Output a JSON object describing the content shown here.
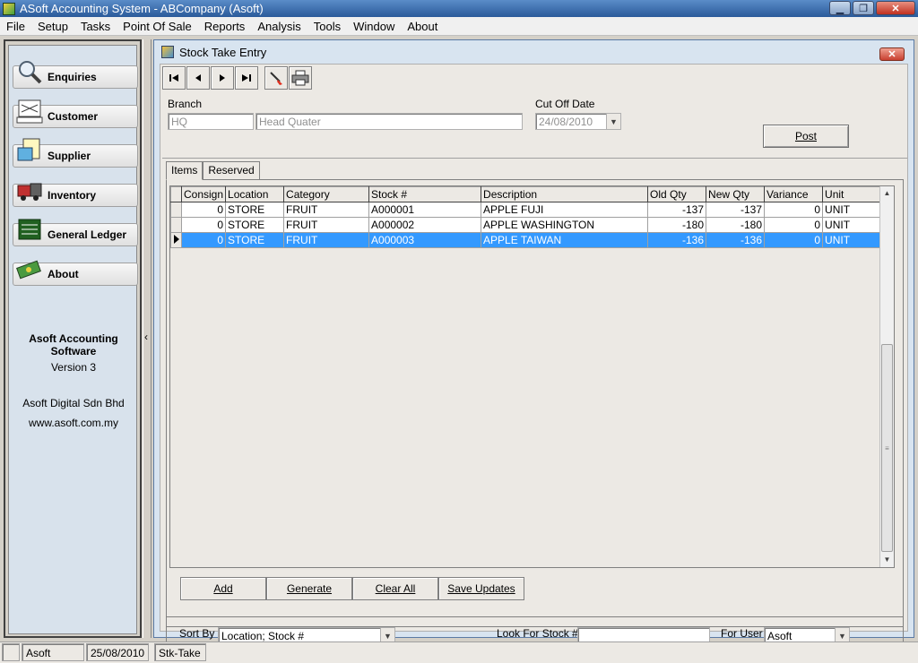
{
  "window": {
    "title": "ASoft Accounting System - ABCompany (Asoft)",
    "minimize": "▁",
    "restore": "❐",
    "close": "✕"
  },
  "menu": [
    "File",
    "Setup",
    "Tasks",
    "Point Of Sale",
    "Reports",
    "Analysis",
    "Tools",
    "Window",
    "About"
  ],
  "sidebar": {
    "items": [
      {
        "label": "Enquiries",
        "icon": "magnifier-icon"
      },
      {
        "label": "Customer",
        "icon": "received-stamp-icon"
      },
      {
        "label": "Supplier",
        "icon": "invoice-icon"
      },
      {
        "label": "Inventory",
        "icon": "delivery-truck-icon"
      },
      {
        "label": "General Ledger",
        "icon": "ledger-book-icon"
      },
      {
        "label": "About",
        "icon": "money-icon"
      }
    ],
    "about": {
      "product": "Asoft Accounting Software",
      "version": "Version 3",
      "company": "Asoft Digital Sdn Bhd",
      "website": "www.asoft.com.my"
    },
    "collapse_arrow": "‹"
  },
  "form": {
    "title": "Stock Take Entry",
    "close": "✕",
    "branch_label": "Branch",
    "branch_code": "HQ",
    "branch_name": "Head Quater",
    "cutoff_label": "Cut Off Date",
    "cutoff_value": "24/08/2010",
    "post_label": "Post",
    "tabs": [
      "Items",
      "Reserved"
    ],
    "grid": {
      "columns": [
        "Consign",
        "Location",
        "Category",
        "Stock #",
        "Description",
        "Old Qty",
        "New Qty",
        "Variance",
        "Unit"
      ],
      "rows": [
        {
          "consign": "0",
          "location": "STORE",
          "category": "FRUIT",
          "stock": "A000001",
          "description": "APPLE FUJI",
          "old_qty": "-137",
          "new_qty": "-137",
          "variance": "0",
          "unit": "UNIT"
        },
        {
          "consign": "0",
          "location": "STORE",
          "category": "FRUIT",
          "stock": "A000002",
          "description": "APPLE WASHINGTON",
          "old_qty": "-180",
          "new_qty": "-180",
          "variance": "0",
          "unit": "UNIT"
        },
        {
          "consign": "0",
          "location": "STORE",
          "category": "FRUIT",
          "stock": "A000003",
          "description": "APPLE TAIWAN",
          "old_qty": "-136",
          "new_qty": "-136",
          "variance": "0",
          "unit": "UNIT"
        }
      ],
      "selected_row": 2
    },
    "buttons": {
      "add": "Add",
      "generate": "Generate",
      "clear_all": "Clear All",
      "save_updates": "Save Updates"
    },
    "sort_by_label": "Sort By",
    "sort_by_value": "Location; Stock #",
    "look_for_label": "Look For Stock #",
    "look_for_value": "",
    "for_user_label": "For User",
    "for_user_value": "Asoft"
  },
  "status": {
    "user": "Asoft",
    "date": "25/08/2010",
    "window_tab": "Stk-Take"
  }
}
